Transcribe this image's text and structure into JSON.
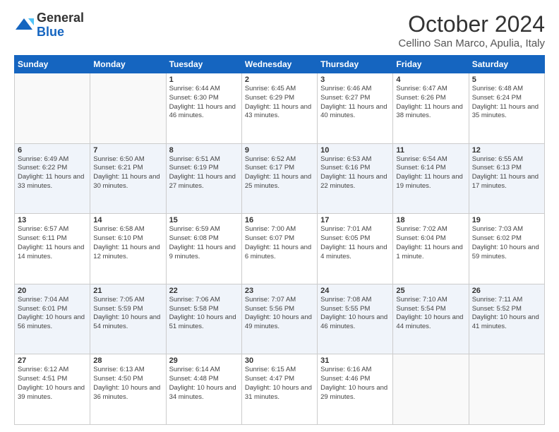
{
  "header": {
    "logo_line1": "General",
    "logo_line2": "Blue",
    "month": "October 2024",
    "location": "Cellino San Marco, Apulia, Italy"
  },
  "weekdays": [
    "Sunday",
    "Monday",
    "Tuesday",
    "Wednesday",
    "Thursday",
    "Friday",
    "Saturday"
  ],
  "weeks": [
    [
      {
        "day": "",
        "info": ""
      },
      {
        "day": "",
        "info": ""
      },
      {
        "day": "1",
        "info": "Sunrise: 6:44 AM\nSunset: 6:30 PM\nDaylight: 11 hours and 46 minutes."
      },
      {
        "day": "2",
        "info": "Sunrise: 6:45 AM\nSunset: 6:29 PM\nDaylight: 11 hours and 43 minutes."
      },
      {
        "day": "3",
        "info": "Sunrise: 6:46 AM\nSunset: 6:27 PM\nDaylight: 11 hours and 40 minutes."
      },
      {
        "day": "4",
        "info": "Sunrise: 6:47 AM\nSunset: 6:26 PM\nDaylight: 11 hours and 38 minutes."
      },
      {
        "day": "5",
        "info": "Sunrise: 6:48 AM\nSunset: 6:24 PM\nDaylight: 11 hours and 35 minutes."
      }
    ],
    [
      {
        "day": "6",
        "info": "Sunrise: 6:49 AM\nSunset: 6:22 PM\nDaylight: 11 hours and 33 minutes."
      },
      {
        "day": "7",
        "info": "Sunrise: 6:50 AM\nSunset: 6:21 PM\nDaylight: 11 hours and 30 minutes."
      },
      {
        "day": "8",
        "info": "Sunrise: 6:51 AM\nSunset: 6:19 PM\nDaylight: 11 hours and 27 minutes."
      },
      {
        "day": "9",
        "info": "Sunrise: 6:52 AM\nSunset: 6:17 PM\nDaylight: 11 hours and 25 minutes."
      },
      {
        "day": "10",
        "info": "Sunrise: 6:53 AM\nSunset: 6:16 PM\nDaylight: 11 hours and 22 minutes."
      },
      {
        "day": "11",
        "info": "Sunrise: 6:54 AM\nSunset: 6:14 PM\nDaylight: 11 hours and 19 minutes."
      },
      {
        "day": "12",
        "info": "Sunrise: 6:55 AM\nSunset: 6:13 PM\nDaylight: 11 hours and 17 minutes."
      }
    ],
    [
      {
        "day": "13",
        "info": "Sunrise: 6:57 AM\nSunset: 6:11 PM\nDaylight: 11 hours and 14 minutes."
      },
      {
        "day": "14",
        "info": "Sunrise: 6:58 AM\nSunset: 6:10 PM\nDaylight: 11 hours and 12 minutes."
      },
      {
        "day": "15",
        "info": "Sunrise: 6:59 AM\nSunset: 6:08 PM\nDaylight: 11 hours and 9 minutes."
      },
      {
        "day": "16",
        "info": "Sunrise: 7:00 AM\nSunset: 6:07 PM\nDaylight: 11 hours and 6 minutes."
      },
      {
        "day": "17",
        "info": "Sunrise: 7:01 AM\nSunset: 6:05 PM\nDaylight: 11 hours and 4 minutes."
      },
      {
        "day": "18",
        "info": "Sunrise: 7:02 AM\nSunset: 6:04 PM\nDaylight: 11 hours and 1 minute."
      },
      {
        "day": "19",
        "info": "Sunrise: 7:03 AM\nSunset: 6:02 PM\nDaylight: 10 hours and 59 minutes."
      }
    ],
    [
      {
        "day": "20",
        "info": "Sunrise: 7:04 AM\nSunset: 6:01 PM\nDaylight: 10 hours and 56 minutes."
      },
      {
        "day": "21",
        "info": "Sunrise: 7:05 AM\nSunset: 5:59 PM\nDaylight: 10 hours and 54 minutes."
      },
      {
        "day": "22",
        "info": "Sunrise: 7:06 AM\nSunset: 5:58 PM\nDaylight: 10 hours and 51 minutes."
      },
      {
        "day": "23",
        "info": "Sunrise: 7:07 AM\nSunset: 5:56 PM\nDaylight: 10 hours and 49 minutes."
      },
      {
        "day": "24",
        "info": "Sunrise: 7:08 AM\nSunset: 5:55 PM\nDaylight: 10 hours and 46 minutes."
      },
      {
        "day": "25",
        "info": "Sunrise: 7:10 AM\nSunset: 5:54 PM\nDaylight: 10 hours and 44 minutes."
      },
      {
        "day": "26",
        "info": "Sunrise: 7:11 AM\nSunset: 5:52 PM\nDaylight: 10 hours and 41 minutes."
      }
    ],
    [
      {
        "day": "27",
        "info": "Sunrise: 6:12 AM\nSunset: 4:51 PM\nDaylight: 10 hours and 39 minutes."
      },
      {
        "day": "28",
        "info": "Sunrise: 6:13 AM\nSunset: 4:50 PM\nDaylight: 10 hours and 36 minutes."
      },
      {
        "day": "29",
        "info": "Sunrise: 6:14 AM\nSunset: 4:48 PM\nDaylight: 10 hours and 34 minutes."
      },
      {
        "day": "30",
        "info": "Sunrise: 6:15 AM\nSunset: 4:47 PM\nDaylight: 10 hours and 31 minutes."
      },
      {
        "day": "31",
        "info": "Sunrise: 6:16 AM\nSunset: 4:46 PM\nDaylight: 10 hours and 29 minutes."
      },
      {
        "day": "",
        "info": ""
      },
      {
        "day": "",
        "info": ""
      }
    ]
  ]
}
